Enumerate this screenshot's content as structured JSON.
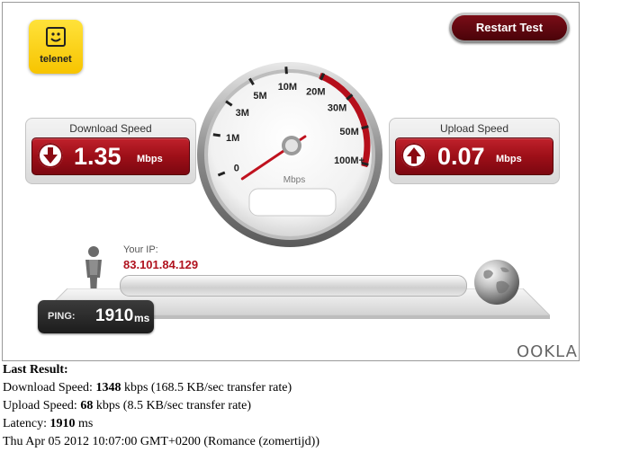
{
  "brand": {
    "logo_text": "telenet",
    "footer_logo": "OOKLA"
  },
  "toolbar": {
    "restart_label": "Restart Test"
  },
  "download": {
    "title": "Download Speed",
    "value": "1.35",
    "unit": "Mbps",
    "icon": "arrow-down-icon"
  },
  "upload": {
    "title": "Upload Speed",
    "value": "0.07",
    "unit": "Mbps",
    "icon": "arrow-up-icon"
  },
  "gauge": {
    "unit_label": "Mbps",
    "ticks": [
      "0",
      "1M",
      "3M",
      "5M",
      "10M",
      "20M",
      "30M",
      "50M",
      "100M+"
    ],
    "needle_value": "1.35"
  },
  "ip": {
    "label": "Your IP:",
    "value": "83.101.84.129"
  },
  "ping": {
    "label": "PING:",
    "value": "1910",
    "unit": "ms"
  },
  "results": {
    "heading": "Last Result:",
    "download_prefix": "Download Speed: ",
    "download_value": "1348",
    "download_suffix": " kbps (168.5 KB/sec transfer rate)",
    "upload_prefix": "Upload Speed: ",
    "upload_value": "68",
    "upload_suffix": " kbps (8.5 KB/sec transfer rate)",
    "latency_prefix": "Latency: ",
    "latency_value": "1910",
    "latency_suffix": " ms",
    "timestamp": "Thu Apr 05 2012 10:07:00 GMT+0200 (Romance (zomertijd))"
  },
  "colors": {
    "accent": "#a3101c",
    "dark_red": "#5a0610",
    "brand_yellow": "#ffd200"
  }
}
